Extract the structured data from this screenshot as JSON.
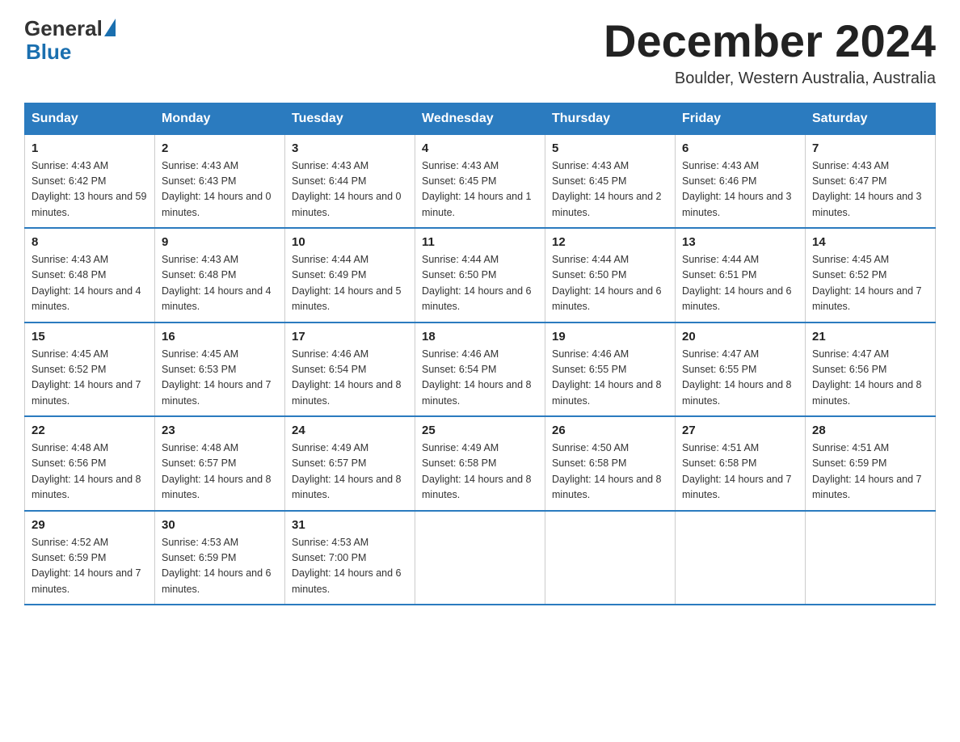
{
  "header": {
    "logo_general": "General",
    "logo_blue": "Blue",
    "month_title": "December 2024",
    "location": "Boulder, Western Australia, Australia"
  },
  "weekdays": [
    "Sunday",
    "Monday",
    "Tuesday",
    "Wednesday",
    "Thursday",
    "Friday",
    "Saturday"
  ],
  "weeks": [
    [
      {
        "day": "1",
        "sunrise": "4:43 AM",
        "sunset": "6:42 PM",
        "daylight": "13 hours and 59 minutes."
      },
      {
        "day": "2",
        "sunrise": "4:43 AM",
        "sunset": "6:43 PM",
        "daylight": "14 hours and 0 minutes."
      },
      {
        "day": "3",
        "sunrise": "4:43 AM",
        "sunset": "6:44 PM",
        "daylight": "14 hours and 0 minutes."
      },
      {
        "day": "4",
        "sunrise": "4:43 AM",
        "sunset": "6:45 PM",
        "daylight": "14 hours and 1 minute."
      },
      {
        "day": "5",
        "sunrise": "4:43 AM",
        "sunset": "6:45 PM",
        "daylight": "14 hours and 2 minutes."
      },
      {
        "day": "6",
        "sunrise": "4:43 AM",
        "sunset": "6:46 PM",
        "daylight": "14 hours and 3 minutes."
      },
      {
        "day": "7",
        "sunrise": "4:43 AM",
        "sunset": "6:47 PM",
        "daylight": "14 hours and 3 minutes."
      }
    ],
    [
      {
        "day": "8",
        "sunrise": "4:43 AM",
        "sunset": "6:48 PM",
        "daylight": "14 hours and 4 minutes."
      },
      {
        "day": "9",
        "sunrise": "4:43 AM",
        "sunset": "6:48 PM",
        "daylight": "14 hours and 4 minutes."
      },
      {
        "day": "10",
        "sunrise": "4:44 AM",
        "sunset": "6:49 PM",
        "daylight": "14 hours and 5 minutes."
      },
      {
        "day": "11",
        "sunrise": "4:44 AM",
        "sunset": "6:50 PM",
        "daylight": "14 hours and 6 minutes."
      },
      {
        "day": "12",
        "sunrise": "4:44 AM",
        "sunset": "6:50 PM",
        "daylight": "14 hours and 6 minutes."
      },
      {
        "day": "13",
        "sunrise": "4:44 AM",
        "sunset": "6:51 PM",
        "daylight": "14 hours and 6 minutes."
      },
      {
        "day": "14",
        "sunrise": "4:45 AM",
        "sunset": "6:52 PM",
        "daylight": "14 hours and 7 minutes."
      }
    ],
    [
      {
        "day": "15",
        "sunrise": "4:45 AM",
        "sunset": "6:52 PM",
        "daylight": "14 hours and 7 minutes."
      },
      {
        "day": "16",
        "sunrise": "4:45 AM",
        "sunset": "6:53 PM",
        "daylight": "14 hours and 7 minutes."
      },
      {
        "day": "17",
        "sunrise": "4:46 AM",
        "sunset": "6:54 PM",
        "daylight": "14 hours and 8 minutes."
      },
      {
        "day": "18",
        "sunrise": "4:46 AM",
        "sunset": "6:54 PM",
        "daylight": "14 hours and 8 minutes."
      },
      {
        "day": "19",
        "sunrise": "4:46 AM",
        "sunset": "6:55 PM",
        "daylight": "14 hours and 8 minutes."
      },
      {
        "day": "20",
        "sunrise": "4:47 AM",
        "sunset": "6:55 PM",
        "daylight": "14 hours and 8 minutes."
      },
      {
        "day": "21",
        "sunrise": "4:47 AM",
        "sunset": "6:56 PM",
        "daylight": "14 hours and 8 minutes."
      }
    ],
    [
      {
        "day": "22",
        "sunrise": "4:48 AM",
        "sunset": "6:56 PM",
        "daylight": "14 hours and 8 minutes."
      },
      {
        "day": "23",
        "sunrise": "4:48 AM",
        "sunset": "6:57 PM",
        "daylight": "14 hours and 8 minutes."
      },
      {
        "day": "24",
        "sunrise": "4:49 AM",
        "sunset": "6:57 PM",
        "daylight": "14 hours and 8 minutes."
      },
      {
        "day": "25",
        "sunrise": "4:49 AM",
        "sunset": "6:58 PM",
        "daylight": "14 hours and 8 minutes."
      },
      {
        "day": "26",
        "sunrise": "4:50 AM",
        "sunset": "6:58 PM",
        "daylight": "14 hours and 8 minutes."
      },
      {
        "day": "27",
        "sunrise": "4:51 AM",
        "sunset": "6:58 PM",
        "daylight": "14 hours and 7 minutes."
      },
      {
        "day": "28",
        "sunrise": "4:51 AM",
        "sunset": "6:59 PM",
        "daylight": "14 hours and 7 minutes."
      }
    ],
    [
      {
        "day": "29",
        "sunrise": "4:52 AM",
        "sunset": "6:59 PM",
        "daylight": "14 hours and 7 minutes."
      },
      {
        "day": "30",
        "sunrise": "4:53 AM",
        "sunset": "6:59 PM",
        "daylight": "14 hours and 6 minutes."
      },
      {
        "day": "31",
        "sunrise": "4:53 AM",
        "sunset": "7:00 PM",
        "daylight": "14 hours and 6 minutes."
      },
      null,
      null,
      null,
      null
    ]
  ],
  "labels": {
    "sunrise": "Sunrise:",
    "sunset": "Sunset:",
    "daylight": "Daylight:"
  }
}
